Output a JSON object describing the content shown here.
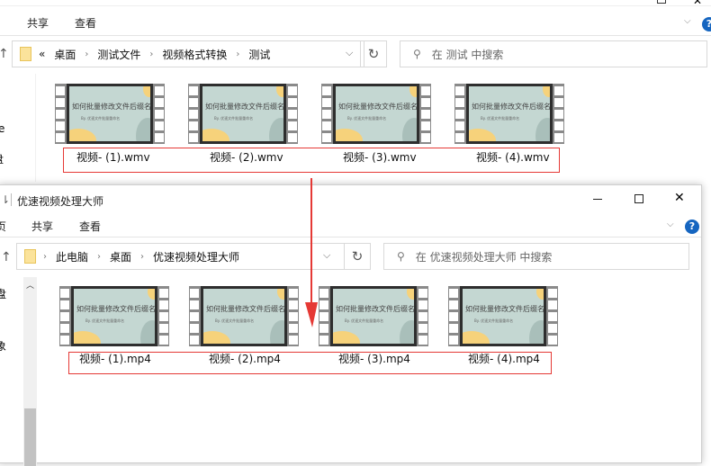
{
  "colors": {
    "accent": "#1565c0",
    "highlight_red": "#e53935",
    "folder": "#fbe39b"
  },
  "top_window": {
    "tabs": [
      "共享",
      "查看"
    ],
    "breadcrumb": {
      "overflow": "«",
      "items": [
        "桌面",
        "测试文件",
        "视频格式转换",
        "测试"
      ]
    },
    "search_placeholder": "在 测试 中搜索",
    "sidebar_fragments": [
      "e",
      "盘"
    ],
    "files": [
      {
        "name": "视频- (1).wmv"
      },
      {
        "name": "视频- (2).wmv"
      },
      {
        "name": "视频- (3).wmv"
      },
      {
        "name": "视频- (4).wmv"
      }
    ]
  },
  "bottom_window": {
    "title": "优速视频处理大师",
    "tabs": [
      "页",
      "共享",
      "查看"
    ],
    "breadcrumb": {
      "items": [
        "此电脑",
        "桌面",
        "优速视频处理大师"
      ]
    },
    "search_placeholder": "在 优速视频处理大师 中搜索",
    "sidebar_fragments": [
      "盘",
      "象"
    ],
    "files": [
      {
        "name": "视频- (1).mp4"
      },
      {
        "name": "视频- (2).mp4"
      },
      {
        "name": "视频- (3).mp4"
      },
      {
        "name": "视频- (4).mp4"
      }
    ]
  },
  "thumbnail": {
    "title": "如何批量修改文件后缀名?",
    "subtitle": "By. 优速文件批量重命名"
  },
  "icons": {
    "up": "arrow-up-icon",
    "refresh": "refresh-icon",
    "search": "search-icon",
    "help": "help-icon",
    "minimize": "minimize-icon",
    "maximize": "maximize-icon",
    "close": "close-icon"
  }
}
